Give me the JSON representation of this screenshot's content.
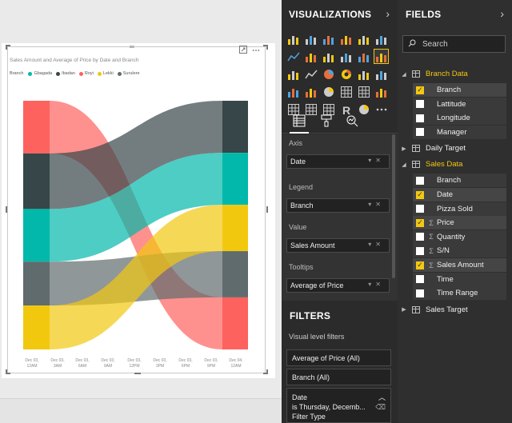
{
  "visual": {
    "title": "Sales Amount and Average of Price by Date and Branch",
    "legend_label": "Branch",
    "legend": [
      {
        "name": "Gbagada",
        "color": "#01b8aa"
      },
      {
        "name": "Ibadan",
        "color": "#374649"
      },
      {
        "name": "Royi",
        "color": "#fd625e"
      },
      {
        "name": "Lekki",
        "color": "#f2c80f"
      },
      {
        "name": "Surulere",
        "color": "#5f6b6d"
      }
    ],
    "expand_icon": "focus-mode-icon",
    "more_icon": "more-options-icon",
    "grip_icon": "drag-grip-icon"
  },
  "chart_data": {
    "type": "area",
    "subtype": "ribbon",
    "title": "Sales Amount and Average of Price by Date and Branch",
    "legend_title": "Branch",
    "x": [
      "Dec 03, 12AM",
      "Dec 03, 3AM",
      "Dec 03, 6AM",
      "Dec 03, 9AM",
      "Dec 03, 12PM",
      "Dec 03, 3PM",
      "Dec 03, 6PM",
      "Dec 03, 9PM",
      "Dec 04, 12AM"
    ],
    "x_tick_lines": [
      [
        "Dec 03,",
        "12AM"
      ],
      [
        "Dec 03,",
        "3AM"
      ],
      [
        "Dec 03,",
        "6AM"
      ],
      [
        "Dec 03,",
        "9AM"
      ],
      [
        "Dec 03,",
        "12PM"
      ],
      [
        "Dec 03,",
        "3PM"
      ],
      [
        "Dec 03,",
        "6PM"
      ],
      [
        "Dec 03,",
        "9PM"
      ],
      [
        "Dec 04,",
        "12AM"
      ]
    ],
    "periods": [
      "Dec 03, 12AM",
      "Dec 04, 12AM"
    ],
    "series": [
      {
        "name": "Royi",
        "color": "#fd625e",
        "rank_start": 1,
        "rank_end": 5,
        "values": [
          18,
          18
        ]
      },
      {
        "name": "Ibadan",
        "color": "#374649",
        "rank_start": 2,
        "rank_end": 1,
        "values": [
          19,
          18
        ]
      },
      {
        "name": "Gbagada",
        "color": "#01b8aa",
        "rank_start": 3,
        "rank_end": 2,
        "values": [
          18,
          18
        ]
      },
      {
        "name": "Surulere",
        "color": "#5f6b6d",
        "rank_start": 4,
        "rank_end": 4,
        "values": [
          15,
          16
        ]
      },
      {
        "name": "Lekki",
        "color": "#f2c80f",
        "rank_start": 5,
        "rank_end": 3,
        "values": [
          15,
          16
        ]
      }
    ],
    "grid": false,
    "legend_position": "top-left"
  },
  "visualizations": {
    "title": "VISUALIZATIONS",
    "collapse_icon": "chevron-right-icon",
    "icons": [
      "stacked-bar-icon",
      "stacked-column-icon",
      "clustered-bar-icon",
      "clustered-column-icon",
      "100-stacked-bar-icon",
      "100-stacked-column-icon",
      "line-chart-icon",
      "area-chart-icon",
      "stacked-area-icon",
      "line-column-icon",
      "line-clustered-column-icon",
      "ribbon-chart-icon",
      "waterfall-icon",
      "scatter-icon",
      "pie-icon",
      "donut-icon",
      "treemap-icon",
      "map-icon",
      "filled-map-icon",
      "funnel-icon",
      "gauge-icon",
      "card-icon",
      "multi-row-card-icon",
      "kpi-icon",
      "slicer-icon",
      "table-icon",
      "matrix-icon",
      "r-script-icon",
      "globe-icon",
      "more-visuals-icon"
    ],
    "selected_icon": "ribbon-chart-icon",
    "tabs": [
      "fields-tab-icon",
      "format-paint-icon",
      "analytics-icon"
    ],
    "wells": [
      {
        "label": "Axis",
        "value": "Date"
      },
      {
        "label": "Legend",
        "value": "Branch"
      },
      {
        "label": "Value",
        "value": "Sales Amount"
      },
      {
        "label": "Tooltips",
        "value": "Average of Price"
      }
    ]
  },
  "filters": {
    "title": "FILTERS",
    "section": "Visual level filters",
    "items": [
      {
        "label": "Average of Price  (All)"
      },
      {
        "label": "Branch  (All)"
      }
    ],
    "date_filter": {
      "label": "Date",
      "condition": "is Thursday, Decemb...",
      "type_label": "Filter Type"
    }
  },
  "fields": {
    "title": "FIELDS",
    "collapse_icon": "chevron-right-icon",
    "search_placeholder": "Search",
    "tables": [
      {
        "name": "Branch Data",
        "expanded": true,
        "fields": [
          {
            "name": "Branch",
            "checked": true,
            "sigma": false
          },
          {
            "name": "Lattitude",
            "checked": false,
            "sigma": false
          },
          {
            "name": "Longitude",
            "checked": false,
            "sigma": false
          },
          {
            "name": "Manager",
            "checked": false,
            "sigma": false
          }
        ]
      },
      {
        "name": "Daily Target",
        "expanded": false,
        "fields": []
      },
      {
        "name": "Sales Data",
        "expanded": true,
        "fields": [
          {
            "name": "Branch",
            "checked": false,
            "sigma": false
          },
          {
            "name": "Date",
            "checked": true,
            "sigma": false
          },
          {
            "name": "Pizza Sold",
            "checked": false,
            "sigma": false
          },
          {
            "name": "Price",
            "checked": true,
            "sigma": true
          },
          {
            "name": "Quantity",
            "checked": false,
            "sigma": true
          },
          {
            "name": "S/N",
            "checked": false,
            "sigma": true
          },
          {
            "name": "Sales Amount",
            "checked": true,
            "sigma": true
          },
          {
            "name": "Time",
            "checked": false,
            "sigma": false
          },
          {
            "name": "Time Range",
            "checked": false,
            "sigma": false
          }
        ]
      },
      {
        "name": "Sales Target",
        "expanded": false,
        "fields": []
      }
    ]
  }
}
